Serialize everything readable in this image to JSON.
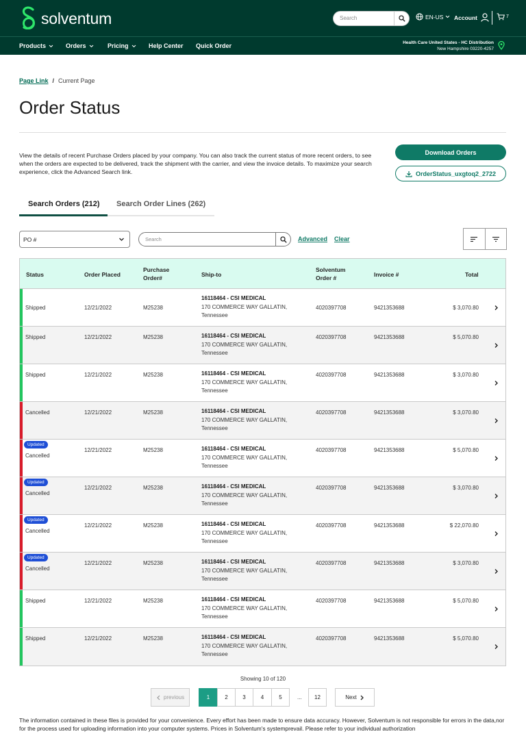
{
  "header": {
    "brand": "solventum",
    "search_placeholder": "Search",
    "language": "EN-US",
    "account_label": "Account",
    "cart_count": "7"
  },
  "nav": {
    "items": [
      {
        "label": "Products",
        "has_menu": true
      },
      {
        "label": "Orders",
        "has_menu": true
      },
      {
        "label": "Pricing",
        "has_menu": true
      },
      {
        "label": "Help Center",
        "has_menu": false
      },
      {
        "label": "Quick Order",
        "has_menu": false
      }
    ],
    "location_line1": "Health Care United States - HC Distribution",
    "location_line2": "New Hampshire 03220-4257"
  },
  "breadcrumb": {
    "link": "Page Link",
    "current": "Current Page"
  },
  "page_title": "Order Status",
  "intro": "View the details of recent Purchase Orders placed by your company. You can also track the current status of more recent orders, to see when the orders are expected to be delivered, track the shipment with the carrier, and view the invoice details. To maximize your search experience, click the Advanced Search link.",
  "actions": {
    "download_label": "Download Orders",
    "file_label": "OrderStatus_uxgtoq2_2722"
  },
  "tabs": [
    {
      "label": "Search Orders (212)",
      "active": true
    },
    {
      "label": "Search Order Lines (262)",
      "active": false
    }
  ],
  "filters": {
    "select_value": "PO #",
    "search_placeholder": "Search",
    "advanced_label": "Advanced",
    "clear_label": "Clear"
  },
  "table": {
    "headers": {
      "status": "Status",
      "order_placed": "Order Placed",
      "purchase_order_1": "Purchase",
      "purchase_order_2": "Order#",
      "ship_to": "Ship-to",
      "solventum_order_1": "Solventum",
      "solventum_order_2": "Order #",
      "invoice": "Invoice #",
      "total": "Total"
    },
    "rows": [
      {
        "status": "Shipped",
        "updated": "",
        "date": "12/21/2022",
        "po": "M25238",
        "ship_name": "16118464 - CSI MEDICAL",
        "ship_addr1": "170 COMMERCE WAY GALLATIN,",
        "ship_addr2": "Tennessee",
        "order_no": "4020397708",
        "invoice": "9421353688",
        "total": "$ 3,070.80"
      },
      {
        "status": "Shipped",
        "updated": "",
        "date": "12/21/2022",
        "po": "M25238",
        "ship_name": "16118464 - CSI MEDICAL",
        "ship_addr1": "170 COMMERCE WAY GALLATIN,",
        "ship_addr2": "Tennessee",
        "order_no": "4020397708",
        "invoice": "9421353688",
        "total": "$ 5,070.80"
      },
      {
        "status": "Shipped",
        "updated": "",
        "date": "12/21/2022",
        "po": "M25238",
        "ship_name": "16118464 - CSI MEDICAL",
        "ship_addr1": "170 COMMERCE WAY GALLATIN,",
        "ship_addr2": "Tennessee",
        "order_no": "4020397708",
        "invoice": "9421353688",
        "total": "$ 3,070.80"
      },
      {
        "status": "Cancelled",
        "updated": "",
        "date": "12/21/2022",
        "po": "M25238",
        "ship_name": "16118464 - CSI MEDICAL",
        "ship_addr1": "170 COMMERCE WAY GALLATIN,",
        "ship_addr2": "Tennessee",
        "order_no": "4020397708",
        "invoice": "9421353688",
        "total": "$ 3,070.80"
      },
      {
        "status": "Cancelled",
        "updated": "Updated",
        "date": "12/21/2022",
        "po": "M25238",
        "ship_name": "16118464 - CSI MEDICAL",
        "ship_addr1": "170 COMMERCE WAY GALLATIN,",
        "ship_addr2": "Tennessee",
        "order_no": "4020397708",
        "invoice": "9421353688",
        "total": "$ 5,070.80"
      },
      {
        "status": "Cancelled",
        "updated": "Updated",
        "date": "12/21/2022",
        "po": "M25238",
        "ship_name": "16118464 - CSI MEDICAL",
        "ship_addr1": "170 COMMERCE WAY GALLATIN,",
        "ship_addr2": "Tennessee",
        "order_no": "4020397708",
        "invoice": "9421353688",
        "total": "$ 3,070.80"
      },
      {
        "status": "Cancelled",
        "updated": "Updated",
        "date": "12/21/2022",
        "po": "M25238",
        "ship_name": "16118464 - CSI MEDICAL",
        "ship_addr1": "170 COMMERCE WAY GALLATIN,",
        "ship_addr2": "Tennessee",
        "order_no": "4020397708",
        "invoice": "9421353688",
        "total": "$ 22,070.80"
      },
      {
        "status": "Cancelled",
        "updated": "Updated",
        "date": "12/21/2022",
        "po": "M25238",
        "ship_name": "16118464 - CSI MEDICAL",
        "ship_addr1": "170 COMMERCE WAY GALLATIN,",
        "ship_addr2": "Tennessee",
        "order_no": "4020397708",
        "invoice": "9421353688",
        "total": "$ 3,070.80"
      },
      {
        "status": "Shipped",
        "updated": "",
        "date": "12/21/2022",
        "po": "M25238",
        "ship_name": "16118464 - CSI MEDICAL",
        "ship_addr1": "170 COMMERCE WAY GALLATIN,",
        "ship_addr2": "Tennessee",
        "order_no": "4020397708",
        "invoice": "9421353688",
        "total": "$ 5,070.80"
      },
      {
        "status": "Shipped",
        "updated": "",
        "date": "12/21/2022",
        "po": "M25238",
        "ship_name": "16118464 - CSI MEDICAL",
        "ship_addr1": "170 COMMERCE WAY GALLATIN,",
        "ship_addr2": "Tennessee",
        "order_no": "4020397708",
        "invoice": "9421353688",
        "total": "$ 5,070.80"
      }
    ]
  },
  "status_colors": {
    "Shipped": "#22c55e",
    "Cancelled": "#d81b2a"
  },
  "pagination": {
    "showing": "Showing 10 of 120",
    "prev_label": "previous",
    "pages": [
      "1",
      "2",
      "3",
      "4",
      "5"
    ],
    "ellipsis": "...",
    "last_page": "12",
    "next_label": "Next",
    "current": "1"
  },
  "disclaimer": "The information contained in these files is provided for your convenience. Every effort has been made to ensure data accuracy. However, Solventum is not responsible for errors in the data,nor for the process used for uploading information into your computer systems. Prices in Solventum's systemprevail. Please refer to your individual authorization"
}
